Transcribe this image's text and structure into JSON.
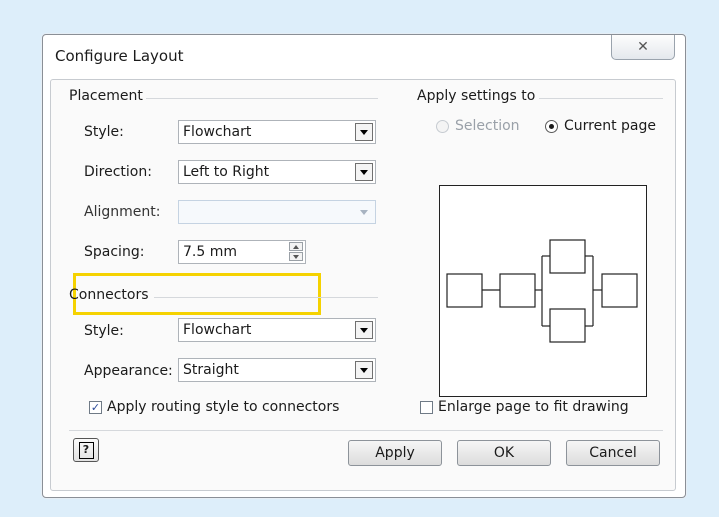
{
  "dialog": {
    "title": "Configure Layout",
    "close_glyph": "✕"
  },
  "placement": {
    "group_label": "Placement",
    "style_label": "Style:",
    "style_value": "Flowchart",
    "direction_label": "Direction:",
    "direction_value": "Left to Right",
    "alignment_label": "Alignment:",
    "alignment_value": "",
    "spacing_label": "Spacing:",
    "spacing_value": "7.5 mm",
    "highlight_color": "#f5d200"
  },
  "connectors": {
    "group_label": "Connectors",
    "style_label": "Style:",
    "style_value": "Flowchart",
    "appearance_label": "Appearance:",
    "appearance_value": "Straight",
    "routing_label": "Apply routing style to connectors",
    "routing_checked": true
  },
  "apply_settings": {
    "group_label": "Apply settings to",
    "selection_label": "Selection",
    "current_page_label": "Current page",
    "selected": "Current page",
    "enlarge_label": "Enlarge page to fit drawing",
    "enlarge_checked": false
  },
  "buttons": {
    "apply": "Apply",
    "ok": "OK",
    "cancel": "Cancel",
    "help_glyph": "?"
  },
  "icons": {
    "close": "close-icon",
    "help": "help-icon",
    "dropdown": "chevron-down-icon"
  }
}
